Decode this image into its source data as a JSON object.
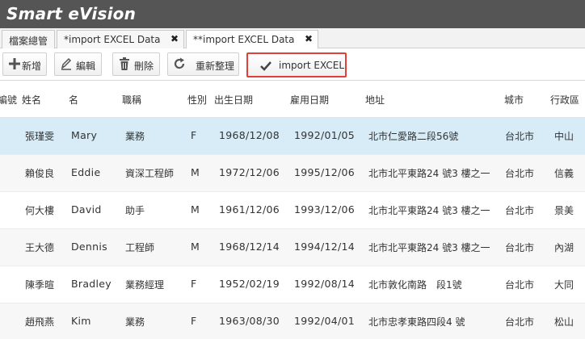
{
  "app": {
    "title": "Smart eVision"
  },
  "tabs": [
    {
      "label": "檔案總管",
      "closable": false,
      "active": false
    },
    {
      "label": "*import EXCEL Data",
      "closable": true,
      "active": false
    },
    {
      "label": "**import EXCEL Data",
      "closable": true,
      "active": true
    }
  ],
  "tab_close_glyph": "✖",
  "toolbar": {
    "add_label": "新增",
    "edit_label": "編輯",
    "delete_label": "刪除",
    "reorganize_label": "重新整理",
    "import_label": "import EXCEL",
    "highlight_color": "#e0403a"
  },
  "table": {
    "headers": [
      "編號",
      "姓名",
      "名",
      "職稱",
      "性別",
      "出生日期",
      "雇用日期",
      "地址",
      "城市",
      "行政區"
    ],
    "selected_row_color": "#d7ecf7",
    "rows": [
      {
        "id": "",
        "name": "張瑾雯",
        "first": "Mary",
        "title": "業務",
        "gender": "F",
        "birth": "1968/12/08",
        "hire": "1992/01/05",
        "address": "北市仁愛路二段56號",
        "city": "台北市",
        "district": "中山"
      },
      {
        "id": "",
        "name": "賴俊良",
        "first": "Eddie",
        "title": "資深工程師",
        "gender": "M",
        "birth": "1972/12/06",
        "hire": "1995/12/06",
        "address": "北市北平東路24 號3 樓之一",
        "city": "台北市",
        "district": "信義"
      },
      {
        "id": "",
        "name": "何大樓",
        "first": "David",
        "title": "助手",
        "gender": "M",
        "birth": "1961/12/06",
        "hire": "1993/12/06",
        "address": "北市北平東路24 號3 樓之一",
        "city": "台北市",
        "district": "景美"
      },
      {
        "id": "",
        "name": "王大德",
        "first": "Dennis",
        "title": "工程師",
        "gender": "M",
        "birth": "1968/12/14",
        "hire": "1994/12/14",
        "address": "北市北平東路24 號3 樓之一",
        "city": "台北市",
        "district": "內湖"
      },
      {
        "id": "",
        "name": "陳季暄",
        "first": "Bradley",
        "title": "業務經理",
        "gender": "F",
        "birth": "1952/02/19",
        "hire": "1992/08/14",
        "address": "北市敦化南路　段1號",
        "city": "台北市",
        "district": "大同"
      },
      {
        "id": "",
        "name": "趙飛燕",
        "first": "Kim",
        "title": "業務",
        "gender": "F",
        "birth": "1963/08/30",
        "hire": "1992/04/01",
        "address": "北市忠孝東路四段4 號",
        "city": "台北市",
        "district": "松山"
      }
    ]
  }
}
